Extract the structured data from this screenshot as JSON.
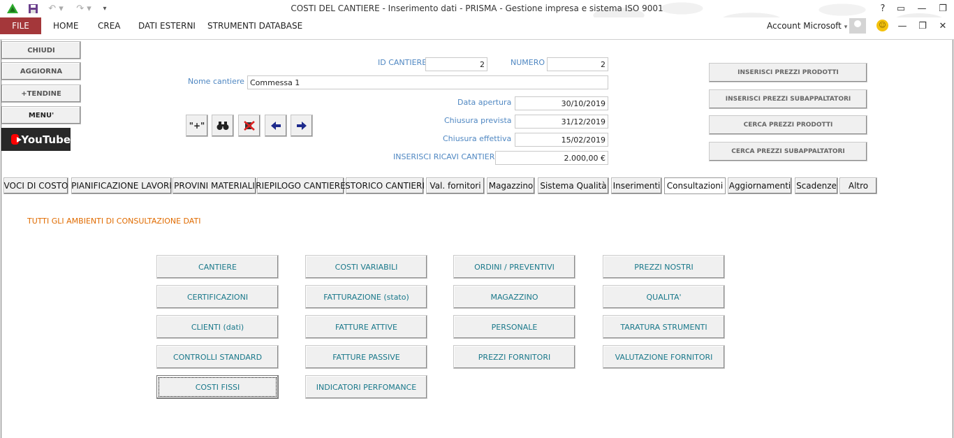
{
  "window": {
    "title": "COSTI DEL CANTIERE - Inserimento dati - PRISMA - Gestione impresa e sistema ISO 9001",
    "help": "?",
    "account": "Account Microsoft"
  },
  "ribbon": {
    "file": "FILE",
    "tabs": [
      "HOME",
      "CREA",
      "DATI ESTERNI",
      "STRUMENTI DATABASE"
    ]
  },
  "side_buttons": [
    "CHIUDI",
    "AGGIORNA",
    "+TENDINE",
    "MENU'"
  ],
  "youtube_label": "YouTube",
  "header_fields": {
    "id_cantiere_label": "ID CANTIERE",
    "id_cantiere_value": "2",
    "numero_label": "NUMERO",
    "numero_value": "2",
    "nome_label": "Nome cantiere",
    "nome_value": "Commessa 1",
    "data_apertura_label": "Data apertura",
    "data_apertura_value": "30/10/2019",
    "chiusura_prevista_label": "Chiusura prevista",
    "chiusura_prevista_value": "31/12/2019",
    "chiusura_effettiva_label": "Chiusura effettiva",
    "chiusura_effettiva_value": "15/02/2019",
    "ricavi_label": "INSERISCI RICAVI CANTIERE",
    "ricavi_value": "2.000,00 €"
  },
  "nav_buttons": {
    "add": "\"+\""
  },
  "right_buttons": [
    "INSERISCI PREZZI PRODOTTI",
    "INSERISCI PREZZI SUBAPPALTATORI",
    "CERCA PREZZI PRODOTTI",
    "CERCA PREZZI SUBAPPALTATORI"
  ],
  "form_tabs": [
    "VOCI DI COSTO",
    "PIANIFICAZIONE LAVORI",
    "PROVINI MATERIALI",
    "RIEPILOGO CANTIERE",
    "STORICO CANTIERI",
    "Val. fornitori",
    "Magazzino",
    "Sistema Qualità",
    "Inserimenti",
    "Consultazioni",
    "Aggiornamenti",
    "Scadenze",
    "Altro"
  ],
  "active_tab": "Consultazioni",
  "section_title": "TUTTI GLI AMBIENTI DI CONSULTAZIONE DATI",
  "consult_buttons": {
    "col1": [
      "CANTIERE",
      "CERTIFICAZIONI",
      "CLIENTI (dati)",
      "CONTROLLI STANDARD",
      "COSTI FISSI"
    ],
    "col2": [
      "COSTI VARIABILI",
      "FATTURAZIONE (stato)",
      "FATTURE ATTIVE",
      "FATTURE PASSIVE",
      "INDICATORI PERFOMANCE"
    ],
    "col3": [
      "ORDINI / PREVENTIVI",
      "MAGAZZINO",
      "PERSONALE",
      "PREZZI FORNITORI"
    ],
    "col4": [
      "PREZZI NOSTRI",
      "QUALITA'",
      "TARATURA STRUMENTI",
      "VALUTAZIONE FORNITORI"
    ]
  },
  "colors": {
    "file_tab": "#a4373a",
    "label_blue": "#4f87c2",
    "section_orange": "#e06b00",
    "button_text_teal": "#19788a"
  }
}
